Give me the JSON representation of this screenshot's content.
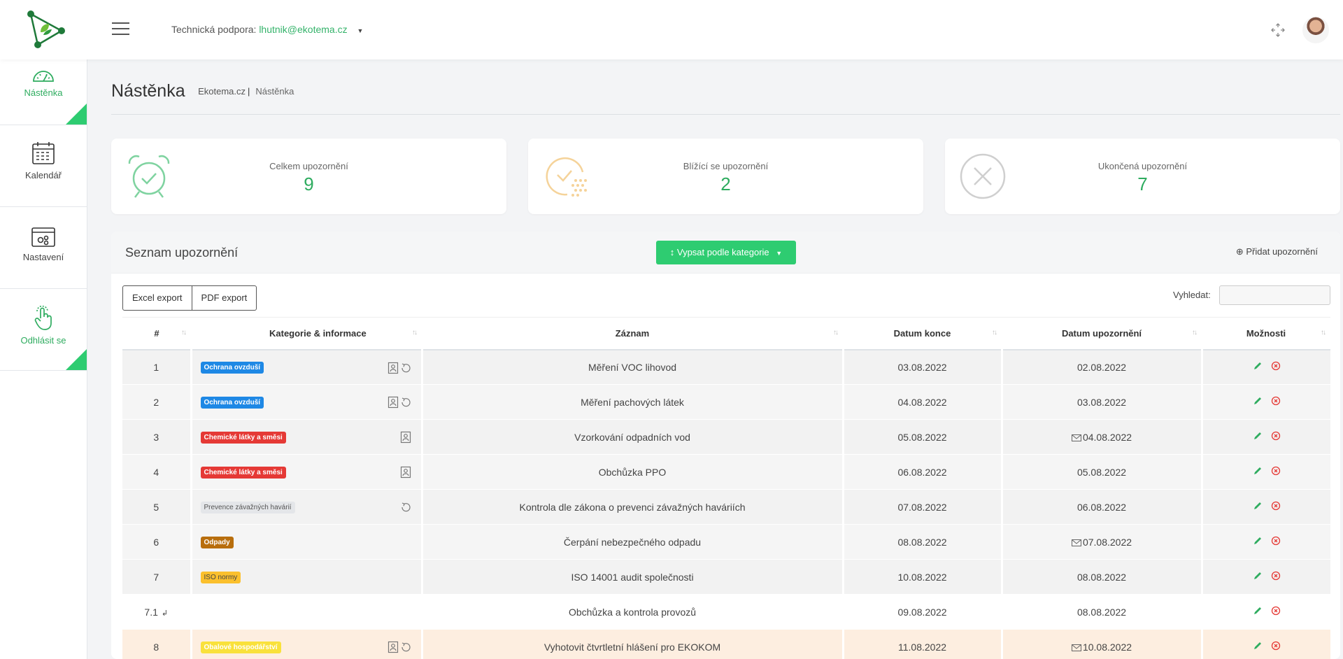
{
  "header": {
    "support_label": "Technická podpora:",
    "support_email": "lhutnik@ekotema.cz"
  },
  "sidebar": {
    "items": [
      {
        "label": "Nástěnka",
        "icon": "gauge-icon"
      },
      {
        "label": "Kalendář",
        "icon": "calendar-icon"
      },
      {
        "label": "Nastavení",
        "icon": "settings-icon"
      },
      {
        "label": "Odhlásit se",
        "icon": "hand-pointer-icon"
      }
    ]
  },
  "page": {
    "title": "Nástěnka",
    "breadcrumb": [
      "Ekotema.cz",
      "Nástěnka"
    ]
  },
  "stats": [
    {
      "title": "Celkem upozornění",
      "value": "9",
      "icon": "alarm-clock-icon"
    },
    {
      "title": "Blížící se upozornění",
      "value": "2",
      "icon": "clock-approaching-icon"
    },
    {
      "title": "Ukončená upozornění",
      "value": "7",
      "icon": "x-circle-icon"
    }
  ],
  "panel": {
    "title": "Seznam upozornění",
    "category_button": "Vypsat podle kategorie",
    "add_button": "Přidat upozornění",
    "excel_export": "Excel export",
    "pdf_export": "PDF export",
    "search_label": "Vyhledat:"
  },
  "table": {
    "columns": [
      "#",
      "Kategorie & informace",
      "Záznam",
      "Datum konce",
      "Datum upozornění",
      "Možnosti"
    ],
    "rows": [
      {
        "num": "1",
        "category": "Ochrana ovzduší",
        "record": "Měření VOC lihovod",
        "end": "03.08.2022",
        "notify": "02.08.2022"
      },
      {
        "num": "2",
        "category": "Ochrana ovzduší",
        "record": "Měření pachových látek",
        "end": "04.08.2022",
        "notify": "03.08.2022"
      },
      {
        "num": "3",
        "category": "Chemické látky a směsi",
        "record": "Vzorkování odpadních vod",
        "end": "05.08.2022",
        "notify": "04.08.2022"
      },
      {
        "num": "4",
        "category": "Chemické látky a směsi",
        "record": "Obchůzka PPO",
        "end": "06.08.2022",
        "notify": "05.08.2022"
      },
      {
        "num": "5",
        "category": "Prevence závažných havárií",
        "record": "Kontrola dle zákona o prevenci závažných haváriích",
        "end": "07.08.2022",
        "notify": "06.08.2022"
      },
      {
        "num": "6",
        "category": "Odpady",
        "record": "Čerpání nebezpečného odpadu",
        "end": "08.08.2022",
        "notify": "07.08.2022"
      },
      {
        "num": "7",
        "category": "ISO normy",
        "record": "ISO 14001 audit společnosti",
        "end": "10.08.2022",
        "notify": "08.08.2022"
      },
      {
        "num": "7.1",
        "category": "",
        "record": "Obchůzka a kontrola provozů",
        "end": "09.08.2022",
        "notify": "08.08.2022"
      },
      {
        "num": "8",
        "category": "Obalové hospodářství",
        "record": "Vyhotovit čtvrtletní hlášení pro EKOKOM",
        "end": "11.08.2022",
        "notify": "10.08.2022"
      }
    ]
  },
  "colors": {
    "accent": "#2ecc71",
    "accent_text": "#2eac5f"
  }
}
